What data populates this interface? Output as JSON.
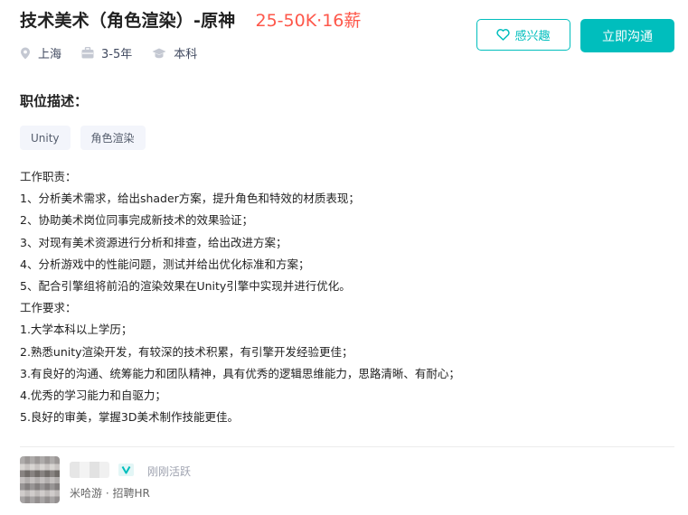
{
  "job": {
    "title": "技术美术（角色渲染）-原神",
    "salary": "25-50K·16薪",
    "location": "上海",
    "experience": "3-5年",
    "degree": "本科"
  },
  "actions": {
    "interest_label": "感兴趣",
    "chat_label": "立即沟通"
  },
  "description": {
    "section_title": "职位描述：",
    "tags": [
      "Unity",
      "角色渲染"
    ],
    "lines": [
      "工作职责：",
      "1、分析美术需求，给出shader方案，提升角色和特效的材质表现；",
      "2、协助美术岗位同事完成新技术的效果验证；",
      "3、对现有美术资源进行分析和排查，给出改进方案；",
      "4、分析游戏中的性能问题，测试并给出优化标准和方案；",
      "5、配合引擎组将前沿的渲染效果在Unity引擎中实现并进行优化。",
      "工作要求：",
      "1.大学本科以上学历；",
      "2.熟悉unity渲染开发，有较深的技术积累，有引擎开发经验更佳；",
      "3.有良好的沟通、统筹能力和团队精神，具有优秀的逻辑思维能力，思路清晰、有耐心；",
      "4.优秀的学习能力和自驱力；",
      "5.良好的审美，掌握3D美术制作技能更佳。"
    ]
  },
  "recruiter": {
    "active_status": "刚刚活跃",
    "company_role": "米哈游 · 招聘HR"
  },
  "colors": {
    "accent": "#00bebd",
    "salary": "#fe574a"
  },
  "icons": {
    "location": "location-pin-icon",
    "experience": "briefcase-icon",
    "degree": "graduation-cap-icon",
    "interest": "heart-icon",
    "verify": "verified-v-icon"
  }
}
